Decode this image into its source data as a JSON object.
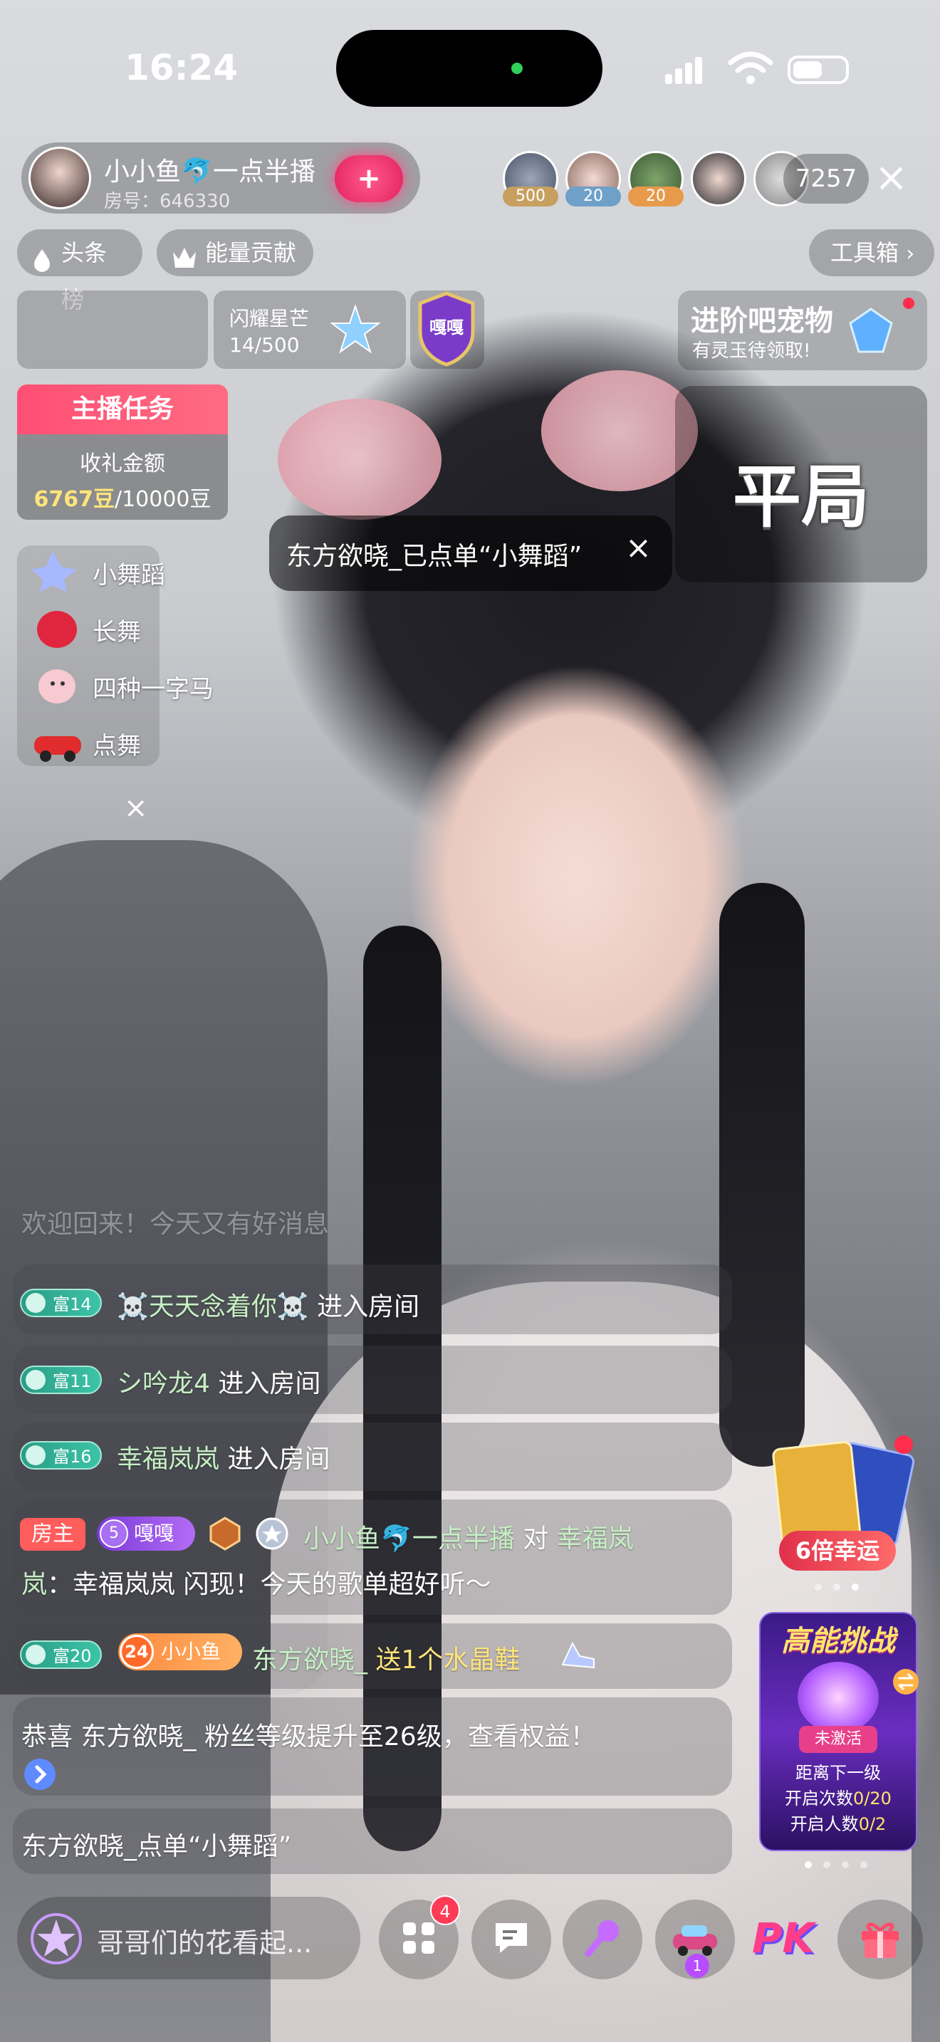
{
  "status_bar": {
    "time": "16:24"
  },
  "host": {
    "name": "小小鱼🐬一点半播",
    "room": "房号：646330",
    "follow_label": "+"
  },
  "viewers": {
    "badges": [
      "500",
      "20",
      "20"
    ],
    "count": "7257",
    "close_label": "×"
  },
  "tags": {
    "headline": "头条榜",
    "energy": "能量贡献",
    "toolbox": "工具箱"
  },
  "widgets": {
    "star_label": "闪耀星芒",
    "star_count": "14/500",
    "shield_text": "嘎嘎",
    "pet_title": "进阶吧宠物",
    "pet_sub": "有灵玉待领取!"
  },
  "task": {
    "title": "主播任务",
    "label": "收礼金额",
    "current": "6767豆",
    "target": "/10000豆"
  },
  "result": {
    "text": "平局"
  },
  "order_toast": {
    "text": "东方欲晓_已点单“小舞蹈”",
    "close": "×"
  },
  "dance_menu": {
    "items": [
      {
        "label": "小舞蹈"
      },
      {
        "label": "长舞"
      },
      {
        "label": "四种一字马"
      },
      {
        "label": "点舞"
      }
    ],
    "close": "×"
  },
  "chat": {
    "faded_top": "欢迎回来！今天又有好消息",
    "rows": [
      {
        "level": "富14",
        "name": "☠️天天念着你☠️",
        "action": "进入房间"
      },
      {
        "level": "富11",
        "name": "シ吟龙4",
        "action": "进入房间"
      },
      {
        "level": "富16",
        "name": "幸福岚岚",
        "action": "进入房间"
      }
    ],
    "host_msg": {
      "tag": "房主",
      "fan_level": "5",
      "fan_name": "嘎嘎",
      "name": "小小鱼🐬一点半播",
      "to": "对",
      "target": "幸福岚",
      "line2_prefix": "岚",
      "line2": "：幸福岚岚 闪现！今天的歌单超好听～"
    },
    "gift_msg": {
      "level": "富20",
      "fan_level": "24",
      "fan_name": "小小鱼",
      "name": "东方欲晓_",
      "action": "送1个水晶鞋"
    },
    "congrats": "恭喜 东方欲晓_ 粉丝等级提升至26级，查看权益！",
    "order_line": "东方欲晓_点单“小舞蹈”"
  },
  "promos": {
    "lucky_label": "6倍幸运",
    "hp_title": "高能挑战",
    "hp_status": "未激活",
    "hp_line1": "距离下一级",
    "hp_line2_label": "开启次数",
    "hp_line2_val": "0/20",
    "hp_line3_label": "开启人数",
    "hp_line3_val": "0/2"
  },
  "bottom": {
    "comment_placeholder": "哥哥们的花看起...",
    "apps_badge": "4",
    "car_badge": "1",
    "pk_label": "PK"
  },
  "colors": {
    "accent_pink": "#ff4f74",
    "level_green": "#2b9c86",
    "gold_text": "#ffe47a",
    "nick_green": "#c6f0c4"
  }
}
